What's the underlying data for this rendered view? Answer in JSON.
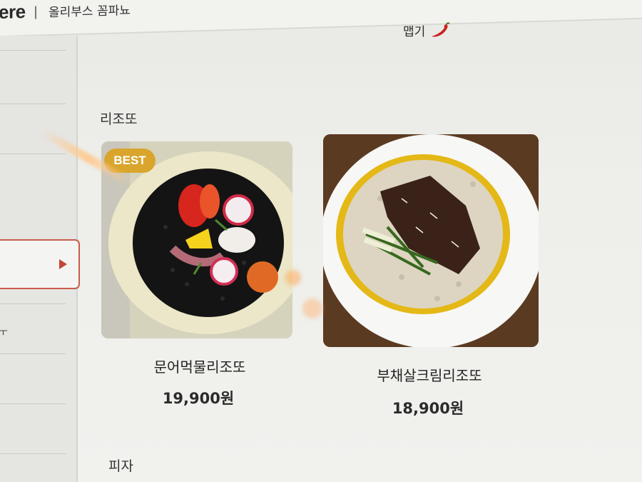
{
  "header": {
    "brand_fragment": "ere",
    "store_name": "올리부스 꼼파뇨"
  },
  "filter": {
    "spicy_label": "맵기",
    "spicy_icon": "chili-pepper-icon"
  },
  "sidebar": {
    "active_arrow_icon": "triangle-right-icon",
    "fragment_text": "ㅜ"
  },
  "sections": [
    {
      "title": "리조또",
      "items": [
        {
          "name": "문어먹물리조또",
          "price": "19,900원",
          "badge": "BEST"
        },
        {
          "name": "부채살크림리조또",
          "price": "18,900원"
        }
      ]
    },
    {
      "title": "피자"
    }
  ],
  "colors": {
    "accent": "#c95c4c",
    "badge": "#d9a52c"
  }
}
